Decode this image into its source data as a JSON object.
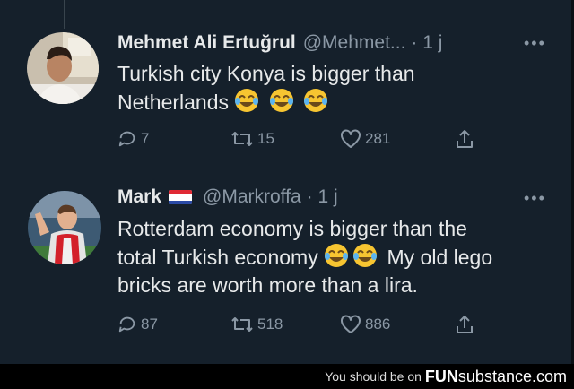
{
  "tweets": [
    {
      "name": "Mehmet Ali Ertuğrul",
      "handle": "@Mehmet...",
      "time": "· 1 j",
      "more": "•••",
      "text_before": "Turkish city Konya is bigger than Netherlands",
      "emojis": [
        "face-with-tears-of-joy",
        "face-with-tears-of-joy",
        "face-with-tears-of-joy"
      ],
      "replies": "7",
      "retweets": "15",
      "likes": "281"
    },
    {
      "name": "Mark",
      "flag": "netherlands-flag",
      "handle": "@Markroffa",
      "time": "· 1 j",
      "more": "•••",
      "text_line1": "Rotterdam economy is bigger than the",
      "text_line2_before": "total Turkish economy",
      "text_line2_after": "My old lego",
      "text_line3": "bricks are worth more than a lira.",
      "emojis": [
        "face-with-tears-of-joy",
        "face-with-tears-of-joy"
      ],
      "replies": "87",
      "retweets": "518",
      "likes": "886"
    }
  ],
  "footer": {
    "prefix": "You should be on",
    "brand_fun": "FUN",
    "brand_sub": "substance",
    "brand_tld": ".com"
  }
}
